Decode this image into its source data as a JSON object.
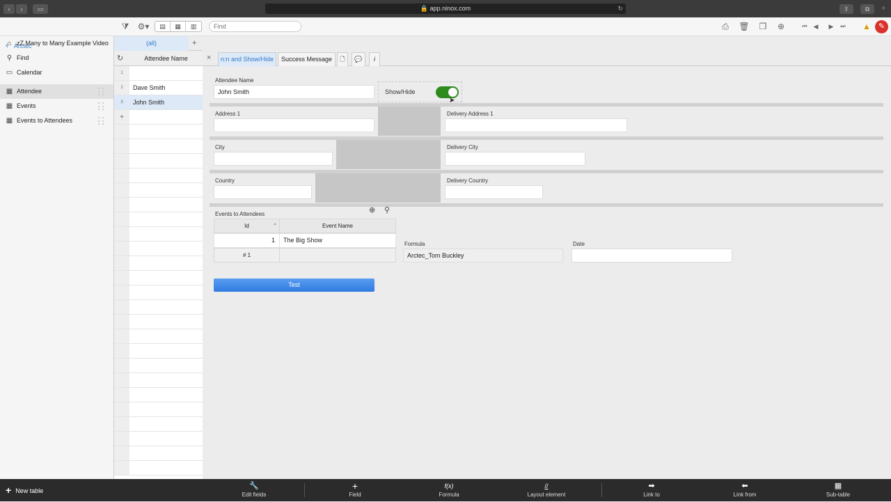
{
  "browser": {
    "url": "app.ninox.com",
    "lock_icon": "lock-icon"
  },
  "toolbar": {
    "find_placeholder": "Find"
  },
  "sidebar": {
    "back_label": "Arctec",
    "items": [
      {
        "label": "zZ Many to Many Example Video",
        "icon": "home-icon"
      },
      {
        "label": "Find",
        "icon": "search-icon"
      },
      {
        "label": "Calendar",
        "icon": "calendar-icon"
      },
      {
        "label": "Attendee",
        "icon": "table-icon",
        "selected": true
      },
      {
        "label": "Events",
        "icon": "table-icon"
      },
      {
        "label": "Events to Attendees",
        "icon": "table-icon"
      }
    ],
    "new_table_label": "New table"
  },
  "list": {
    "tab_all": "(all)",
    "add_tab": "+",
    "column_header": "Attendee Name",
    "rows": [
      {
        "num": "1",
        "name": ""
      },
      {
        "num": "2",
        "name": "Dave Smith"
      },
      {
        "num": "3",
        "name": "John Smith"
      }
    ],
    "add_row": "+"
  },
  "form_tabs": {
    "close": "×",
    "tabs": [
      "n:n and Show/Hide",
      "Success Message"
    ]
  },
  "form": {
    "attendee_name_label": "Attendee Name",
    "attendee_name_value": "John Smith",
    "showhide_label": "Show/Hide",
    "showhide_on": true,
    "address1_label": "Address 1",
    "delivery_address1_label": "Delivery Address 1",
    "city_label": "City",
    "delivery_city_label": "Delivery City",
    "country_label": "Country",
    "delivery_country_label": "Delivery Country",
    "subtable_label": "Events to Attendees",
    "subtable_headers": [
      "Id",
      "Event Name"
    ],
    "subtable_rows": [
      {
        "id": "1",
        "event": "The Big Show"
      }
    ],
    "subtable_count": "# 1",
    "formula_label": "Formula",
    "formula_value": "Arctec_Tom Buckley",
    "date_label": "Date",
    "date_value": "",
    "test_button": "Test"
  },
  "bottombar": {
    "buttons": [
      "Edit fields",
      "Field",
      "Formula",
      "Layout element",
      "Link to",
      "Link from",
      "Sub-table"
    ]
  },
  "colors": {
    "accent": "#3478c6",
    "toggle_on": "#2e8b1e",
    "button_blue": "#2f7be0"
  }
}
